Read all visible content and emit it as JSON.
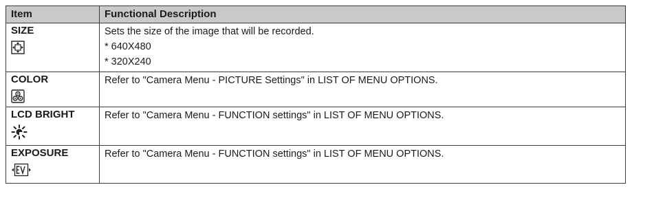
{
  "table": {
    "headers": {
      "item": "Item",
      "description": "Functional Description"
    },
    "rows": [
      {
        "item": "SIZE",
        "icon": "size-icon",
        "description_lines": [
          "Sets the size of the image that will be recorded.",
          "* 640X480",
          "* 320X240"
        ]
      },
      {
        "item": "COLOR",
        "icon": "color-icon",
        "description_lines": [
          "Refer to \"Camera Menu - PICTURE Settings\" in LIST OF MENU OPTIONS."
        ]
      },
      {
        "item": "LCD BRIGHT",
        "icon": "lcd-brightness-icon",
        "description_lines": [
          "Refer to \"Camera Menu - FUNCTION settings\" in LIST OF MENU OPTIONS."
        ]
      },
      {
        "item": "EXPOSURE",
        "icon": "exposure-ev-icon",
        "description_lines": [
          "Refer to \"Camera Menu - FUNCTION settings\" in LIST OF MENU OPTIONS."
        ]
      }
    ]
  }
}
